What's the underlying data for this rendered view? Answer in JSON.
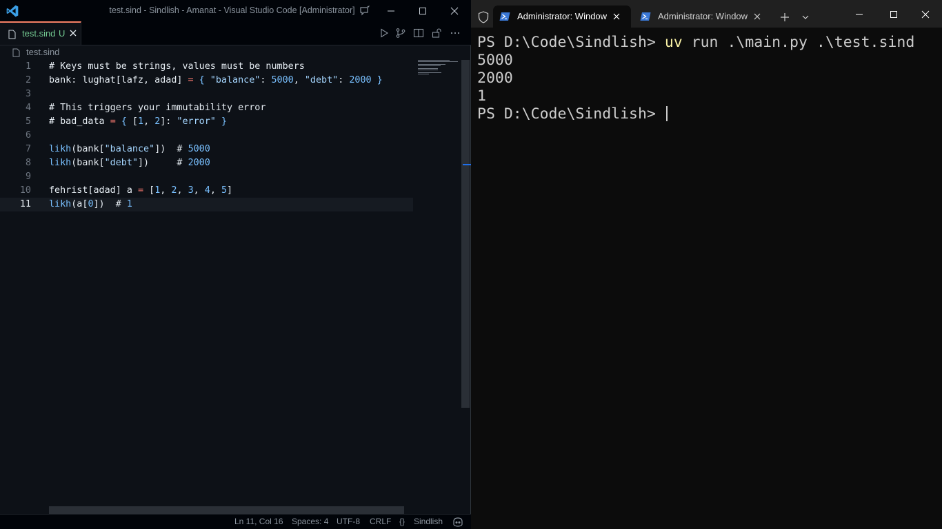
{
  "vscode": {
    "title": "test.sind - Sindlish - Amanat - Visual Studio Code [Administrator]",
    "tab": {
      "filename": "test.sind",
      "status": "U"
    },
    "breadcrumb": "test.sind",
    "lines": [
      {
        "n": "1",
        "text": "# Keys must be strings, values must be numbers"
      },
      {
        "n": "2",
        "text": "bank: lughat[lafz, adad] = { \"balance\": 5000, \"debt\": 2000 }"
      },
      {
        "n": "3",
        "text": ""
      },
      {
        "n": "4",
        "text": "# This triggers your immutability error"
      },
      {
        "n": "5",
        "text": "# bad_data = { [1, 2]: \"error\" }"
      },
      {
        "n": "6",
        "text": ""
      },
      {
        "n": "7",
        "text": "likh(bank[\"balance\"])  # 5000"
      },
      {
        "n": "8",
        "text": "likh(bank[\"debt\"])     # 2000"
      },
      {
        "n": "9",
        "text": ""
      },
      {
        "n": "10",
        "text": "fehrist[adad] a = [1, 2, 3, 4, 5]"
      },
      {
        "n": "11",
        "text": "likh(a[0])  # 1"
      }
    ],
    "status": {
      "position": "Ln 11, Col 16",
      "spaces": "Spaces: 4",
      "encoding": "UTF-8",
      "eol": "CRLF",
      "braces": "{}",
      "language": "Sindlish"
    }
  },
  "terminal": {
    "tabs": [
      {
        "title": "Administrator: Windows PowerShell",
        "active": true
      },
      {
        "title": "Administrator: Windows PowerShell",
        "active": false
      }
    ],
    "prompt": "PS D:\\Code\\Sindlish> ",
    "command": {
      "exe": "uv",
      "args": " run .\\main.py .\\test.sind"
    },
    "output": [
      "5000",
      "2000",
      "1"
    ]
  },
  "colors": {
    "editor_bg": "#0d1117",
    "terminal_bg": "#0c0c0c",
    "command_yellow": "#f9f1a5",
    "tab_modified_green": "#73c991"
  }
}
